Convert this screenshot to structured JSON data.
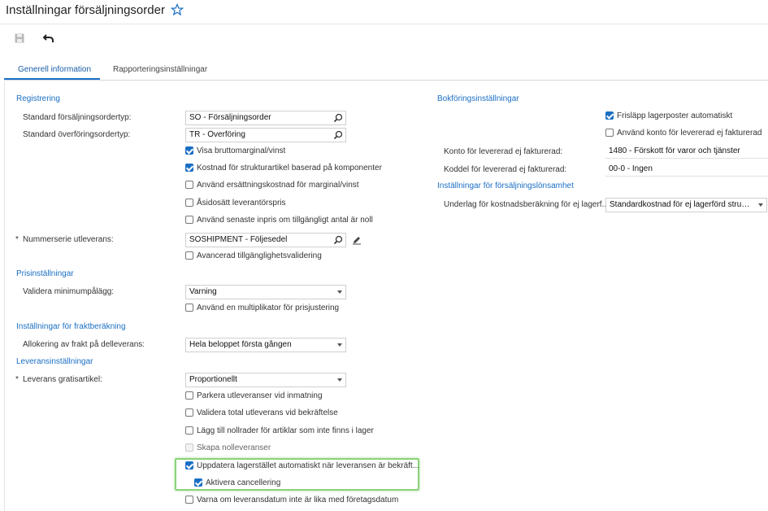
{
  "header": {
    "title": "Inställningar försäljningsorder",
    "favorite_icon": "star-outline-icon"
  },
  "toolbar": {
    "save_icon": "floppy-disk-icon",
    "undo_icon": "undo-arrow-icon"
  },
  "tabs": [
    {
      "label": "Generell information",
      "active": true
    },
    {
      "label": "Rapporteringsinställningar",
      "active": false
    }
  ],
  "left": {
    "registrering": {
      "title": "Registrering",
      "standard_sales_order_type": {
        "label": "Standard försäljningsordertyp:",
        "value": "SO - Försäljningsorder"
      },
      "standard_transfer_order_type": {
        "label": "Standard överföringsordertyp:",
        "value": "TR - Överföring"
      },
      "checkboxes": [
        {
          "label": "Visa bruttomarginal/vinst",
          "checked": true
        },
        {
          "label": "Kostnad för strukturartikel baserad på komponenter",
          "checked": true
        },
        {
          "label": "Använd ersättningskostnad för marginal/vinst",
          "checked": false
        },
        {
          "label": "Åsidosätt leverantörspris",
          "checked": false
        },
        {
          "label": "Använd senaste inpris om tillgängligt antal är noll",
          "checked": false
        }
      ],
      "shipment_numbering": {
        "label": "Nummerserie utleverans:",
        "value": "SOSHIPMENT - Följesedel",
        "required": "*"
      },
      "advanced_availability": {
        "label": "Avancerad tillgänglighetsvalidering",
        "checked": false
      }
    },
    "prisinstallningar": {
      "title": "Prisinställningar",
      "validate_min_markup": {
        "label": "Validera minimumpålägg:",
        "value": "Varning"
      },
      "multiplier": {
        "label": "Använd en multiplikator för prisjustering",
        "checked": false
      }
    },
    "frakt": {
      "title": "Inställningar för fraktberäkning",
      "allocation": {
        "label": "Allokering av frakt på delleverans:",
        "value": "Hela beloppet första gången"
      }
    },
    "leverans": {
      "title": "Leveransinställningar",
      "free_item": {
        "label": "Leverans gratisartikel:",
        "value": "Proportionellt",
        "required": "*"
      },
      "checkboxes": [
        {
          "label": "Parkera utleveranser vid inmatning",
          "checked": false,
          "disabled": false
        },
        {
          "label": "Validera total utleverans vid bekräftelse",
          "checked": false,
          "disabled": false
        },
        {
          "label": "Lägg till nollrader för artiklar som inte finns i lager",
          "checked": false,
          "disabled": false
        },
        {
          "label": "Skapa nolleveranser",
          "checked": false,
          "disabled": true
        },
        {
          "label": "Uppdatera lagerstället automatiskt när leveransen är bekräft...",
          "checked": true,
          "disabled": false
        },
        {
          "label": "Aktivera cancellering",
          "checked": true,
          "disabled": false
        },
        {
          "label": "Varna om leveransdatum inte är lika med företagsdatum",
          "checked": false,
          "disabled": false
        }
      ]
    }
  },
  "right": {
    "bokforing": {
      "title": "Bokföringsinställningar",
      "checkboxes": [
        {
          "label": "Frisläpp lagerposter automatiskt",
          "checked": true
        },
        {
          "label": "Använd konto för levererad ej fakturerad",
          "checked": false
        }
      ],
      "account": {
        "label": "Konto för levererad ej fakturerad:",
        "value": "1480 - Förskott för varor och tjänster"
      },
      "subaccount": {
        "label": "Koddel för levererad ej fakturerad:",
        "value": "00-0 - Ingen"
      }
    },
    "lonsamhet": {
      "title": "Inställningar för försäljningslönsamhet",
      "cost_basis": {
        "label": "Underlag för kostnadsberäkning för ej lagerf...",
        "value": "Standardkostnad för ej lagerförd strukturar"
      }
    }
  }
}
